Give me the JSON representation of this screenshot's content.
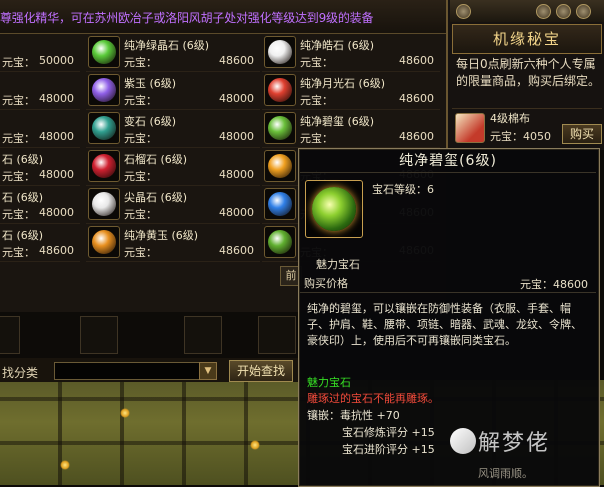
{
  "ticker": "尊强化精华，可在苏州欧冶子或洛阳风胡子处对强化等级达到9级的装备",
  "shop": {
    "price_label": "元宝：",
    "rows": [
      {
        "left": {
          "name": "",
          "price": "50000"
        },
        "mid": {
          "name": "纯净绿晶石 (6级)",
          "price": "48600",
          "color": "#5acb3a"
        },
        "right": {
          "name": "纯净皓石 (6级)",
          "price": "48600",
          "color": "#f0f0f0"
        }
      },
      {
        "left": {
          "name": "",
          "price": "48000"
        },
        "mid": {
          "name": "紫玉 (6级)",
          "price": "48000",
          "color": "#9060e8"
        },
        "right": {
          "name": "纯净月光石 (6级)",
          "price": "48600",
          "color": "#e04030"
        }
      },
      {
        "left": {
          "name": "",
          "price": "48000"
        },
        "mid": {
          "name": "变石 (6级)",
          "price": "48000",
          "color": "#30a090"
        },
        "right": {
          "name": "纯净碧玺 (6级)",
          "price": "48600",
          "color": "#6ac03a"
        }
      },
      {
        "left": {
          "name": "石 (6级)",
          "price": "48000"
        },
        "mid": {
          "name": "石榴石 (6级)",
          "price": "48000",
          "color": "#d02030"
        },
        "right": {
          "name": "",
          "price": "48600",
          "color": "#f0a020"
        }
      },
      {
        "left": {
          "name": "石 (6级)",
          "price": "48000"
        },
        "mid": {
          "name": "尖晶石 (6级)",
          "price": "48000",
          "color": "#e8e8e8"
        },
        "right": {
          "name": "",
          "price": "48600",
          "color": "#3080e8"
        }
      },
      {
        "left": {
          "name": "石 (6级)",
          "price": "48600"
        },
        "mid": {
          "name": "纯净黄玉 (6级)",
          "price": "48600",
          "color": "#e89020"
        },
        "right": {
          "name": "",
          "price": "48600",
          "color": "#60b030"
        }
      }
    ],
    "page_button": "前",
    "search_label": "找分类",
    "search_value": "",
    "start_search": "开始查找"
  },
  "sidebar": {
    "title": "机缘秘宝",
    "description": "每日0点刷新六种个人专属的限量商品，购买后绑定。",
    "item_name": "4级棉布",
    "item_price": "元宝：4050",
    "buy": "购买"
  },
  "tooltip": {
    "title": "纯净碧玺(6级)",
    "level": "宝石等级：6",
    "category": "魅力宝石",
    "buy_price_label": "购买价格",
    "buy_price": "元宝：48600",
    "description": "纯净的碧玺，可以镶嵌在防御性装备（衣服、手套、帽子、护肩、鞋、腰带、项链、暗器、武魂、龙纹、令牌、豪侠印）上，使用后不可再镶嵌同类宝石。",
    "type_green": "魅力宝石",
    "warn_red": "雕琢过的宝石不能再雕琢。",
    "inlay": "镶嵌：毒抗性 +70",
    "eval1": "宝石修炼评分 +15",
    "eval2": "宝石进阶评分 +15"
  },
  "watermark": "解梦佬",
  "footer_text": "风调雨顺。"
}
